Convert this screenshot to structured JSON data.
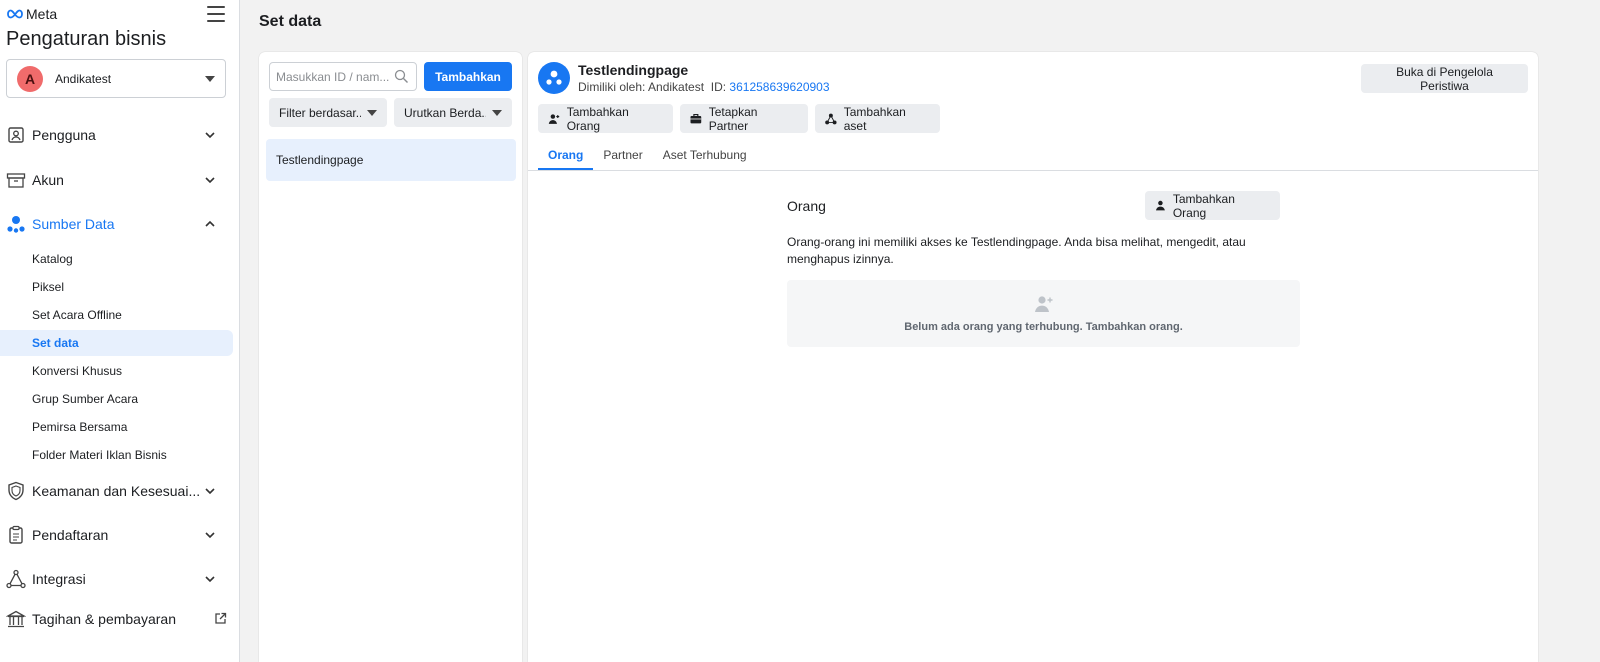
{
  "brand": {
    "logo_text": "Meta"
  },
  "sidebar": {
    "title": "Pengaturan bisnis",
    "account": {
      "initial": "A",
      "name": "Andikatest"
    },
    "items": [
      {
        "label": "Pengguna",
        "icon": "user-badge-icon"
      },
      {
        "label": "Akun",
        "icon": "archive-box-icon"
      },
      {
        "label": "Sumber Data",
        "icon": "data-sources-icon"
      },
      {
        "label": "Keamanan dan Kesesuai...",
        "icon": "shield-icon"
      },
      {
        "label": "Pendaftaran",
        "icon": "clipboard-icon"
      },
      {
        "label": "Integrasi",
        "icon": "integration-icon"
      },
      {
        "label": "Tagihan & pembayaran",
        "icon": "bank-icon"
      }
    ],
    "sub_items": [
      "Katalog",
      "Piksel",
      "Set Acara Offline",
      "Set data",
      "Konversi Khusus",
      "Grup Sumber Acara",
      "Pemirsa Bersama",
      "Folder Materi Iklan Bisnis"
    ]
  },
  "page": {
    "title": "Set data"
  },
  "list_panel": {
    "search_placeholder": "Masukkan ID / nam...",
    "add_button": "Tambahkan",
    "filter_label": "Filter berdasar...",
    "sort_label": "Urutkan Berda...",
    "entries": [
      "Testlendingpage"
    ]
  },
  "detail": {
    "name": "Testlendingpage",
    "owner_prefix": "Dimiliki oleh: Andikatest",
    "id_prefix": "ID:",
    "id_value": "361258639620903",
    "open_button": "Buka di Pengelola Peristiwa",
    "actions": {
      "add_people": "Tambahkan Orang",
      "assign_partner": "Tetapkan Partner",
      "add_asset": "Tambahkan aset"
    },
    "tabs": [
      "Orang",
      "Partner",
      "Aset Terhubung"
    ],
    "section": {
      "title": "Orang",
      "add_button": "Tambahkan Orang",
      "description": "Orang-orang ini memiliki akses ke Testlendingpage. Anda bisa melihat, mengedit, atau menghapus izinnya.",
      "empty_text": "Belum ada orang yang terhubung. Tambahkan orang."
    }
  },
  "colors": {
    "accent": "#1877f2",
    "avatar": "#f06b6b",
    "selected_bg": "#e7f0fd"
  }
}
